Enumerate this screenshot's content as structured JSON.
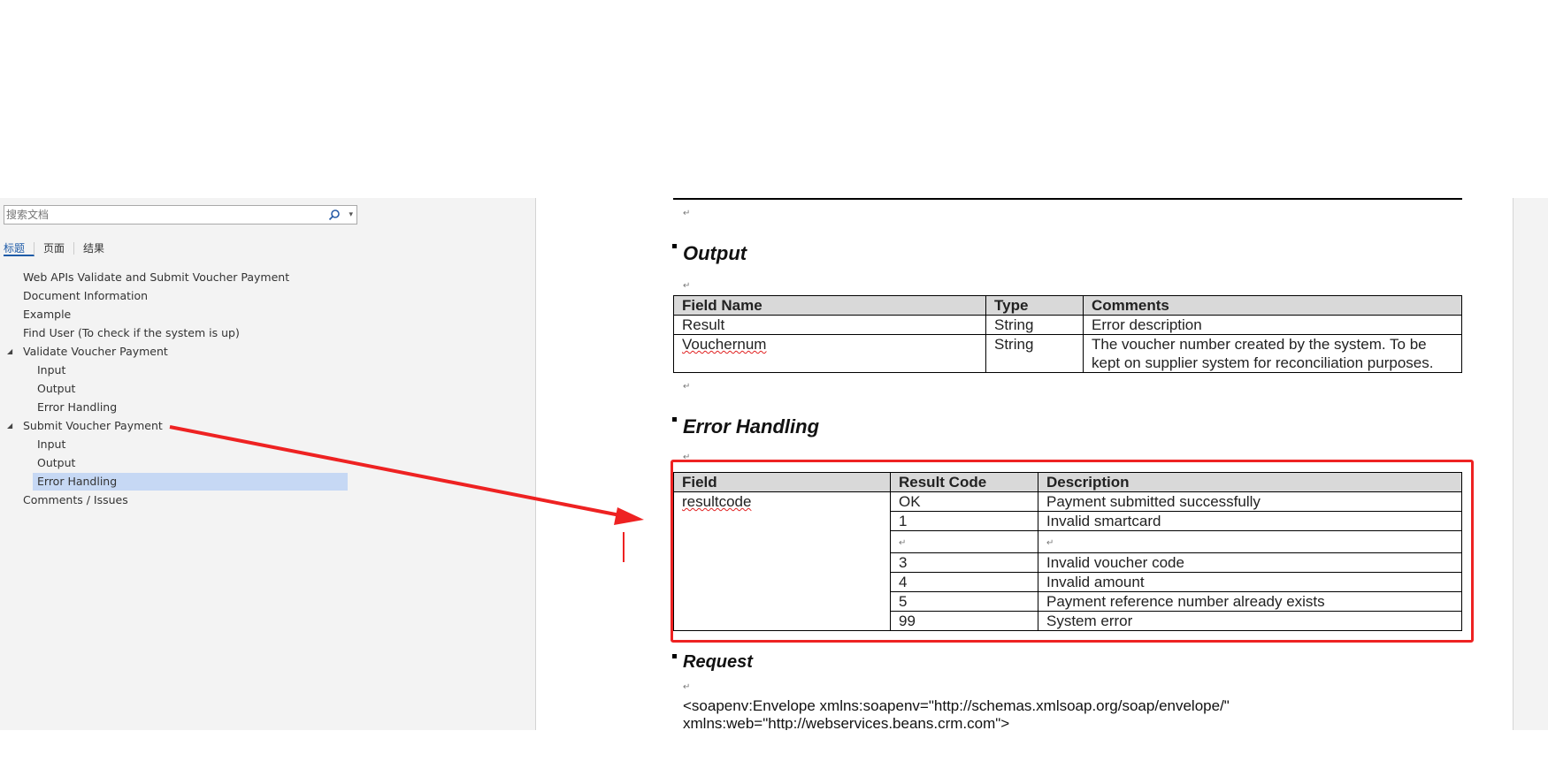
{
  "nav": {
    "search_placeholder": "搜索文档",
    "tabs": [
      "标题",
      "页面",
      "结果"
    ],
    "items": [
      {
        "label": "Web APIs Validate and Submit Voucher Payment",
        "level": 1
      },
      {
        "label": "Document Information",
        "level": 1
      },
      {
        "label": "Example",
        "level": 1
      },
      {
        "label": "Find User (To check if the system is up)",
        "level": 1
      },
      {
        "label": "Validate Voucher Payment",
        "level": 1,
        "expanded": true
      },
      {
        "label": "Input",
        "level": 2
      },
      {
        "label": "Output",
        "level": 2
      },
      {
        "label": "Error Handling",
        "level": 2
      },
      {
        "label": "Submit Voucher Payment",
        "level": 1,
        "expanded": true
      },
      {
        "label": "Input",
        "level": 2
      },
      {
        "label": "Output",
        "level": 2
      },
      {
        "label": "Error Handling",
        "level": 2,
        "selected": true
      },
      {
        "label": "Comments / Issues",
        "level": 1
      }
    ]
  },
  "doc": {
    "output_heading": "Output",
    "output_table": {
      "headers": [
        "Field Name",
        "Type",
        "Comments"
      ],
      "rows": [
        [
          "Result",
          "String",
          "Error description"
        ],
        [
          "Vouchernum",
          "String",
          "The voucher number created by the system. To be kept on supplier system for reconciliation purposes."
        ]
      ]
    },
    "error_heading": "Error Handling",
    "error_table": {
      "headers": [
        "Field",
        "Result Code",
        "Description"
      ],
      "field": "resultcode",
      "rows": [
        [
          "OK",
          "Payment submitted successfully "
        ],
        [
          "1",
          "Invalid smartcard"
        ],
        [
          "",
          ""
        ],
        [
          "3",
          "Invalid voucher code"
        ],
        [
          "4",
          "Invalid amount"
        ],
        [
          "5",
          "Payment reference number already exists"
        ],
        [
          "99",
          "System error"
        ]
      ]
    },
    "request_heading": "Request",
    "request_line1": "<soapenv:Envelope xmlns:soapenv=\"http://schemas.xmlsoap.org/soap/envelope/\"",
    "request_line2": "xmlns:web=\"http://webservices.beans.crm.com\">",
    "paragraph_mark": "↵"
  },
  "colors": {
    "highlight": "#ee2222",
    "arrow": "#ee2222",
    "nav_selected": "#c6d8f4",
    "table_header": "#d9d9d9"
  }
}
